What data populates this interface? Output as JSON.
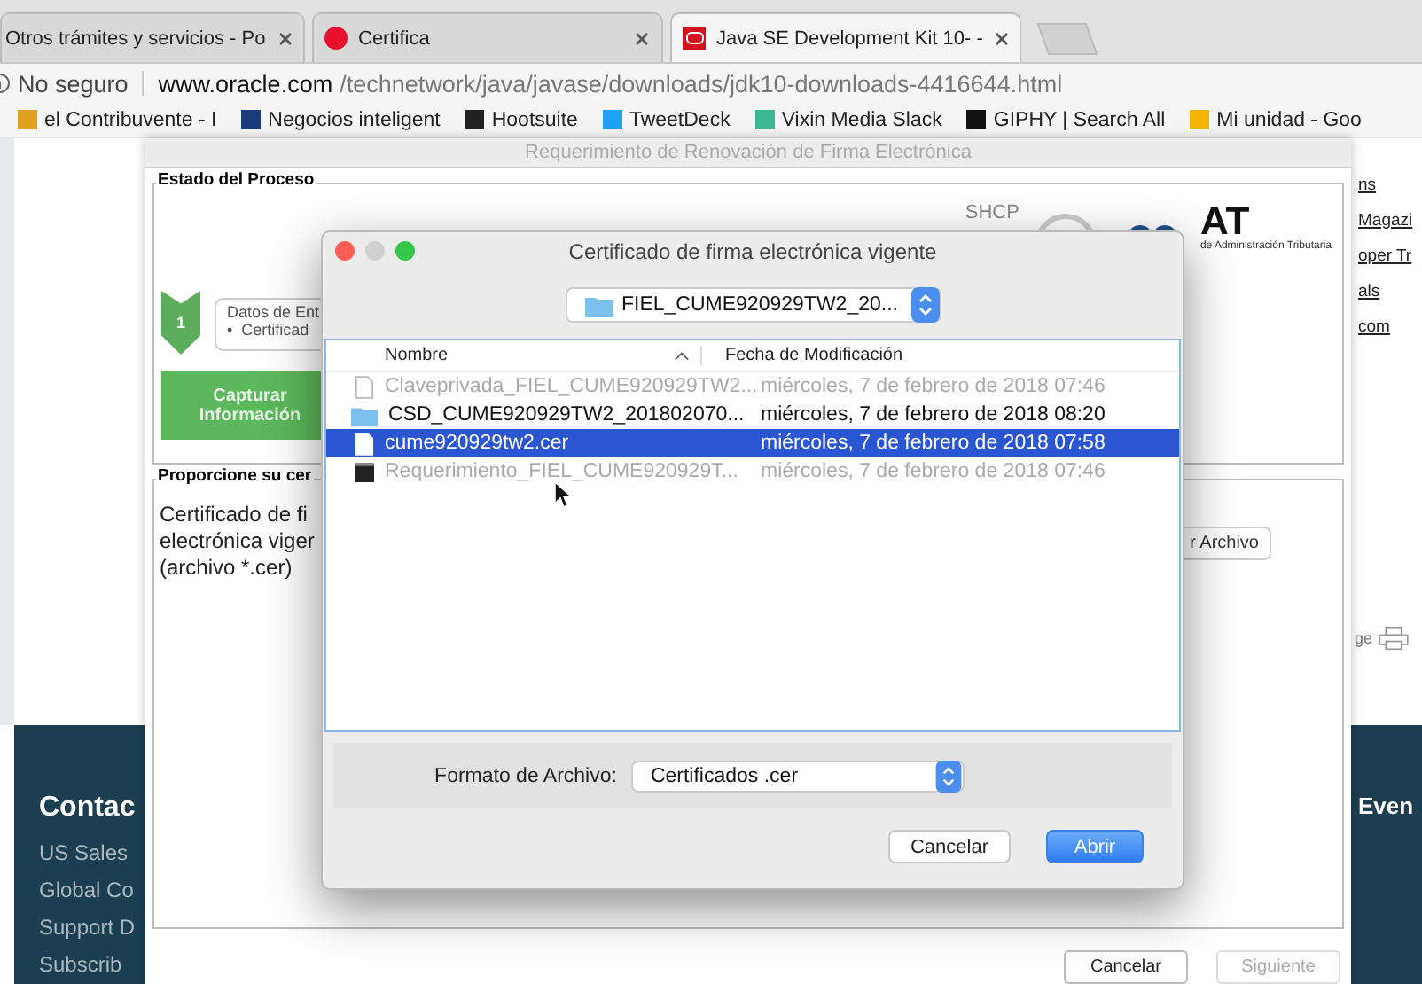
{
  "browser": {
    "tabs": [
      {
        "title": "Otros trámites y servicios - Po",
        "kind": "plain",
        "selected": false
      },
      {
        "title": "Certifica",
        "kind": "dot",
        "selected": false
      },
      {
        "title": "Java SE Development Kit 10- -",
        "kind": "logo",
        "selected": true
      }
    ],
    "address": {
      "security": "No seguro",
      "host": "www.oracle.com",
      "path": "/technetwork/java/javase/downloads/jdk10-downloads-4416644.html"
    },
    "bookmarks": [
      {
        "label": "el Contribuvente - I",
        "color": "#e0a020"
      },
      {
        "label": "Negocios inteligent",
        "color": "#1a3a7a"
      },
      {
        "label": "Hootsuite",
        "color": "#222222"
      },
      {
        "label": "TweetDeck",
        "color": "#1da1f2"
      },
      {
        "label": "Vixin Media Slack",
        "color": "#3eb890"
      },
      {
        "label": "GIPHY | Search All",
        "color": "#111111"
      },
      {
        "label": "Mi unidad - Goo",
        "color": "#f4b400"
      }
    ]
  },
  "page": {
    "side_links": [
      "ns",
      "Magazi",
      "oper Tr",
      "als",
      "com"
    ],
    "share_label": "ge",
    "footer": {
      "heading": "Contac",
      "links": [
        "US Sales",
        "Global Co",
        "Support D",
        "Subscrib"
      ],
      "right_heading": "Even"
    }
  },
  "java_window": {
    "title": "Requerimiento de Renovación de Firma Electrónica",
    "status_section": {
      "legend": "Estado del Proceso",
      "step_number": "1",
      "step_title": "Datos de Ent",
      "bullet": "•",
      "step_item": "Certificad",
      "action": "Capturar Información",
      "logo": {
        "top": "SHCP",
        "brand": "AT",
        "subtitle": "de Administración Tributaria"
      }
    },
    "certificate_section": {
      "legend": "Proporcione su cer",
      "lines": [
        "Certificado de fi",
        "electrónica viger",
        "(archivo *.cer)"
      ],
      "browse_button": "r Archivo"
    },
    "buttons": [
      {
        "label": "Cancelar",
        "disabled": false
      },
      {
        "label": "Siguiente",
        "disabled": true
      }
    ]
  },
  "dialog": {
    "title": "Certificado de firma electrónica vigente",
    "folder": "FIEL_CUME920929TW2_20...",
    "columns": [
      "Nombre",
      "Fecha de Modificación"
    ],
    "files": [
      {
        "kind": "file",
        "name": "Claveprivada_FIEL_CUME920929TW2...",
        "date": "miércoles, 7 de febrero de 2018 07:46",
        "disabled": true,
        "selected": false
      },
      {
        "kind": "folder",
        "name": "CSD_CUME920929TW2_201802070...",
        "date": "miércoles, 7 de febrero de 2018 08:20",
        "disabled": false,
        "selected": false
      },
      {
        "kind": "file",
        "name": "cume920929tw2.cer",
        "date": "miércoles, 7 de febrero de 2018 07:58",
        "disabled": false,
        "selected": true
      },
      {
        "kind": "terminal",
        "name": "Requerimiento_FIEL_CUME920929T...",
        "date": "miércoles, 7 de febrero de 2018 07:46",
        "disabled": true,
        "selected": false
      }
    ],
    "format_label": "Formato de Archivo:",
    "format": "Certificados .cer",
    "buttons": [
      {
        "label": "Cancelar",
        "kind": "secondary"
      },
      {
        "label": "Abrir",
        "kind": "primary"
      }
    ]
  }
}
